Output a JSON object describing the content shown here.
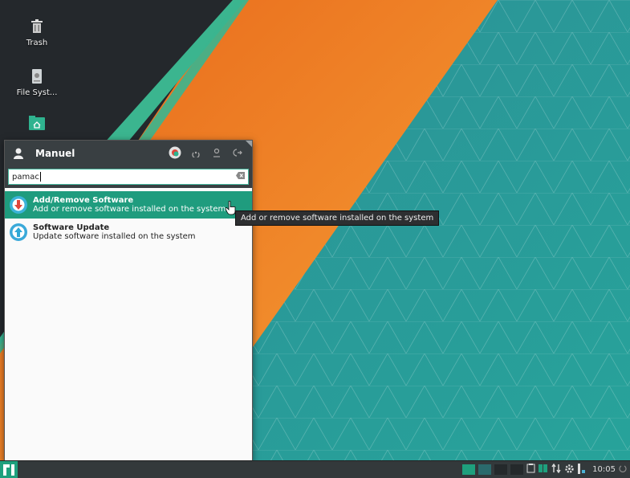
{
  "desktop": {
    "icons": [
      {
        "label": "Trash",
        "icon": "trash-icon"
      },
      {
        "label": "File Syst...",
        "icon": "drive-icon"
      },
      {
        "label": "",
        "icon": "home-folder-icon"
      }
    ]
  },
  "menu": {
    "user_name": "Manuel",
    "search": {
      "value": "pamac"
    },
    "results": [
      {
        "title": "Add/Remove Software",
        "subtitle": "Add or remove software installed on the system",
        "icon": "pamac-add-remove-icon"
      },
      {
        "title": "Software Update",
        "subtitle": "Update software installed on the system",
        "icon": "software-update-icon"
      }
    ]
  },
  "tooltip": {
    "text": "Add or remove software installed on the system"
  },
  "taskbar": {
    "clock": "10:05"
  },
  "colors": {
    "accent": "#1f9c7e",
    "wallpaper_teal": "#2aa39a",
    "stripe_orange": "#f47a1c"
  }
}
